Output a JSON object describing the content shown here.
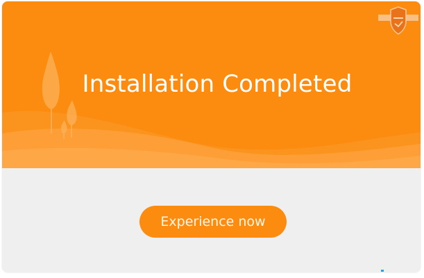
{
  "window": {
    "title": "Installation Completed"
  },
  "banner": {
    "background_color": "#fb8c10",
    "logo_icon": "shield-logo-icon"
  },
  "actions": {
    "experience_label": "Experience now"
  }
}
